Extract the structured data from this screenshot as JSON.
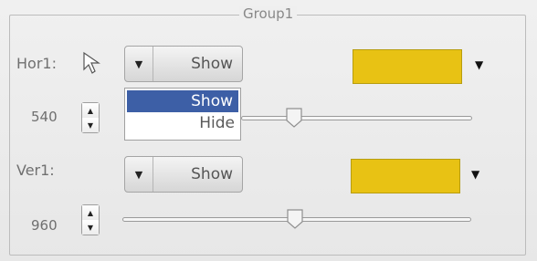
{
  "group": {
    "title": "Group1"
  },
  "hor": {
    "label": "Hor1:",
    "value": "540",
    "combo_value": "Show",
    "color": "#e8c214",
    "slider_fraction": 0.49,
    "dropdown_options": [
      "Show",
      "Hide"
    ],
    "dropdown_selected": "Show"
  },
  "ver": {
    "label": "Ver1:",
    "value": "960",
    "combo_value": "Show",
    "color": "#e8c214",
    "slider_fraction": 0.49
  },
  "icons": {
    "cursor": "arrow-cursor-icon",
    "spin_up": "triangle-up-icon",
    "spin_down": "triangle-down-icon",
    "combo_arrow": "triangle-down-icon",
    "color_arrow": "triangle-down-icon"
  }
}
